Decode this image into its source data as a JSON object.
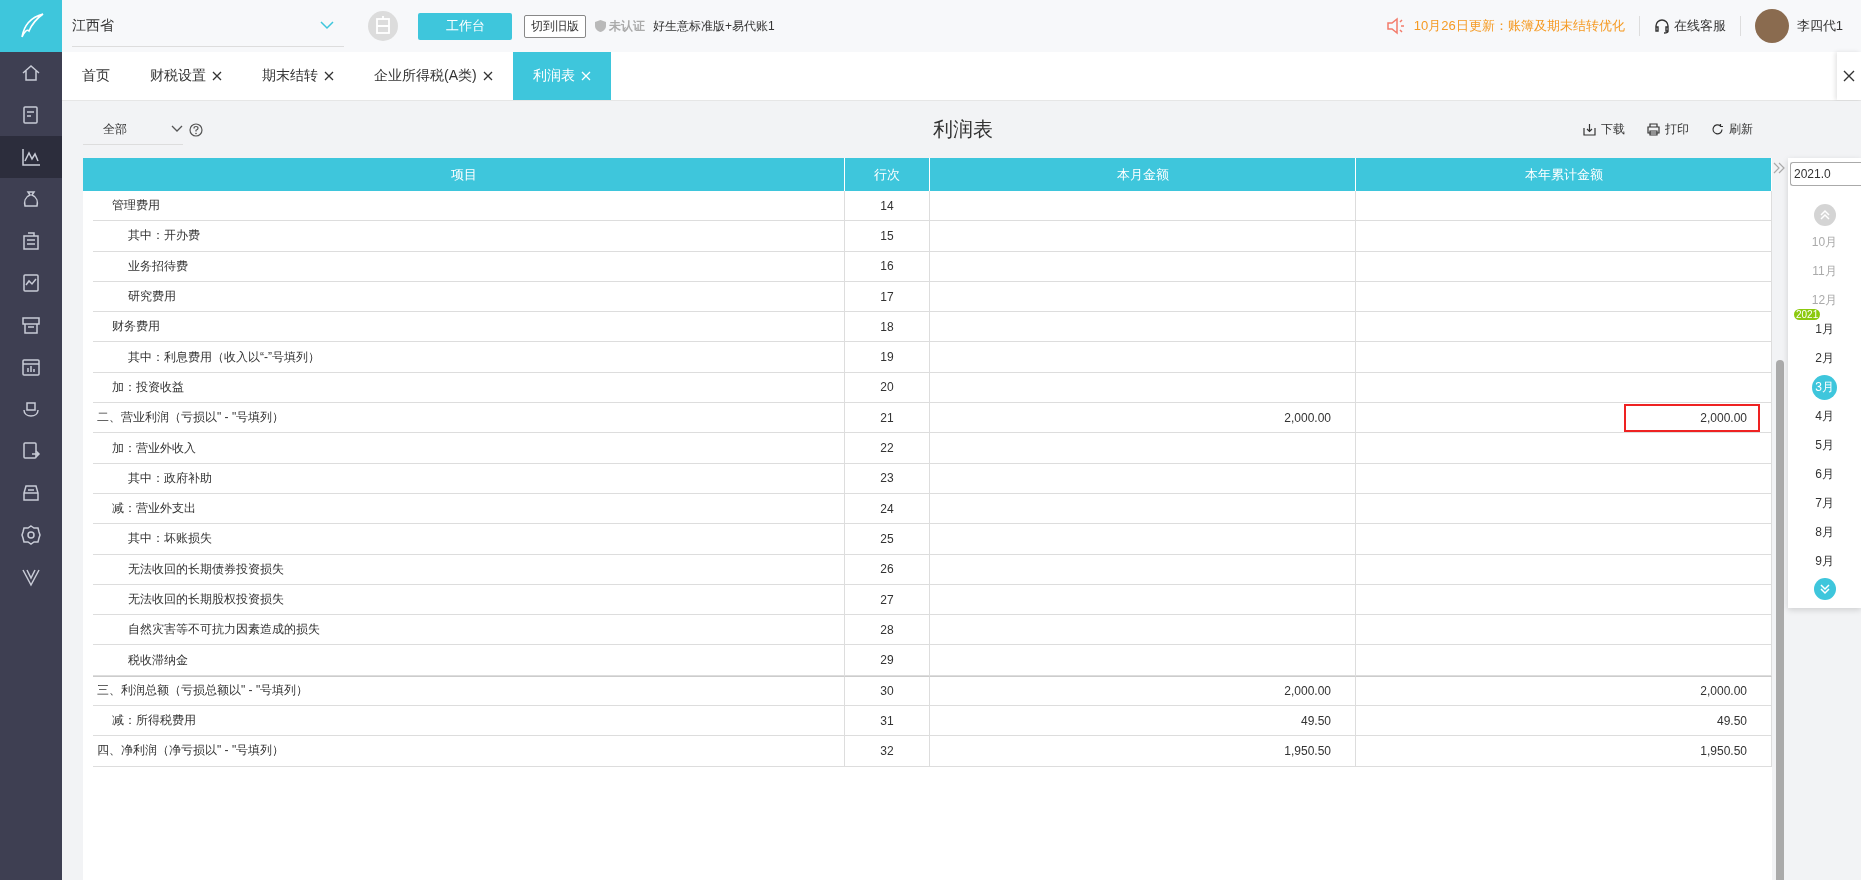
{
  "top_bar": {
    "region": "江西省",
    "workbench_button": "工作台",
    "old_version_button": "切到旧版",
    "auth_status": "未认证",
    "company": "好生意标准版+易代账1",
    "notice": "10月26日更新：账簿及期末结转优化",
    "support": "在线客服",
    "user": "李四代1"
  },
  "sidebar": {
    "items": [
      {
        "selected": false
      },
      {
        "selected": false
      },
      {
        "selected": true
      },
      {
        "selected": false
      },
      {
        "selected": false
      },
      {
        "selected": false
      },
      {
        "selected": false
      },
      {
        "selected": false
      },
      {
        "selected": false
      },
      {
        "selected": false
      },
      {
        "selected": false
      },
      {
        "selected": false
      },
      {
        "selected": false
      }
    ]
  },
  "tabs": [
    {
      "label": "首页",
      "closable": false,
      "selected": false
    },
    {
      "label": "财税设置",
      "closable": true,
      "selected": false
    },
    {
      "label": "期末结转",
      "closable": true,
      "selected": false
    },
    {
      "label": "企业所得税(A类)",
      "closable": true,
      "selected": false
    },
    {
      "label": "利润表",
      "closable": true,
      "selected": true
    }
  ],
  "toolbar": {
    "filter": "全部",
    "title": "利润表",
    "actions": [
      "下载",
      "打印",
      "刷新"
    ]
  },
  "table": {
    "columns": [
      "项目",
      "行次",
      "本月金额",
      "本年累计金额"
    ],
    "rows": [
      {
        "kind": "item",
        "name": "管理费用",
        "line": "14",
        "month": "",
        "year": "",
        "marked": false
      },
      {
        "kind": "sub",
        "name": "其中：开办费",
        "line": "15",
        "month": "",
        "year": "",
        "marked": false
      },
      {
        "kind": "sub",
        "name": "业务招待费",
        "line": "16",
        "month": "",
        "year": "",
        "marked": false
      },
      {
        "kind": "sub",
        "name": "研究费用",
        "line": "17",
        "month": "",
        "year": "",
        "marked": false
      },
      {
        "kind": "item",
        "name": "财务费用",
        "line": "18",
        "month": "",
        "year": "",
        "marked": false
      },
      {
        "kind": "sub",
        "name": "其中：利息费用（收入以“-”号填列）",
        "line": "19",
        "month": "",
        "year": "",
        "marked": false
      },
      {
        "kind": "item",
        "name": "加：投资收益",
        "line": "20",
        "month": "",
        "year": "",
        "marked": false
      },
      {
        "kind": "section",
        "name": "二、营业利润（亏损以\" - \"号填列）",
        "line": "21",
        "month": "2,000.00",
        "year": "2,000.00",
        "marked": true
      },
      {
        "kind": "item",
        "name": "加：营业外收入",
        "line": "22",
        "month": "",
        "year": "",
        "marked": false
      },
      {
        "kind": "sub",
        "name": "其中：政府补助",
        "line": "23",
        "month": "",
        "year": "",
        "marked": false
      },
      {
        "kind": "item",
        "name": "减：营业外支出",
        "line": "24",
        "month": "",
        "year": "",
        "marked": false
      },
      {
        "kind": "sub",
        "name": "其中：坏账损失",
        "line": "25",
        "month": "",
        "year": "",
        "marked": false
      },
      {
        "kind": "sub",
        "name": "无法收回的长期债券投资损失",
        "line": "26",
        "month": "",
        "year": "",
        "marked": false
      },
      {
        "kind": "sub",
        "name": "无法收回的长期股权投资损失",
        "line": "27",
        "month": "",
        "year": "",
        "marked": false
      },
      {
        "kind": "sub",
        "name": "自然灾害等不可抗力因素造成的损失",
        "line": "28",
        "month": "",
        "year": "",
        "marked": false
      },
      {
        "kind": "sub",
        "name": "税收滞纳金",
        "line": "29",
        "month": "",
        "year": "",
        "marked": false
      },
      {
        "kind": "section",
        "name": "三、利润总额（亏损总额以\" - \"号填列）",
        "line": "30",
        "month": "2,000.00",
        "year": "2,000.00",
        "marked": false
      },
      {
        "kind": "item",
        "name": "减：所得税费用",
        "line": "31",
        "month": "49.50",
        "year": "49.50",
        "marked": false
      },
      {
        "kind": "section",
        "name": "四、净利润（净亏损以\" - \"号填列）",
        "line": "32",
        "month": "1,950.50",
        "year": "1,950.50",
        "marked": false
      }
    ]
  },
  "period_picker": {
    "value": "2021.0",
    "year_badge": "2021",
    "months": [
      {
        "label": "10月",
        "dimmed": true,
        "selected": false
      },
      {
        "label": "11月",
        "dimmed": true,
        "selected": false
      },
      {
        "label": "12月",
        "dimmed": true,
        "selected": false
      },
      {
        "label": "1月",
        "dimmed": false,
        "selected": false
      },
      {
        "label": "2月",
        "dimmed": false,
        "selected": false
      },
      {
        "label": "3月",
        "dimmed": false,
        "selected": true
      },
      {
        "label": "4月",
        "dimmed": false,
        "selected": false
      },
      {
        "label": "5月",
        "dimmed": false,
        "selected": false
      },
      {
        "label": "6月",
        "dimmed": false,
        "selected": false
      },
      {
        "label": "7月",
        "dimmed": false,
        "selected": false
      },
      {
        "label": "8月",
        "dimmed": false,
        "selected": false
      },
      {
        "label": "9月",
        "dimmed": false,
        "selected": false
      }
    ]
  }
}
